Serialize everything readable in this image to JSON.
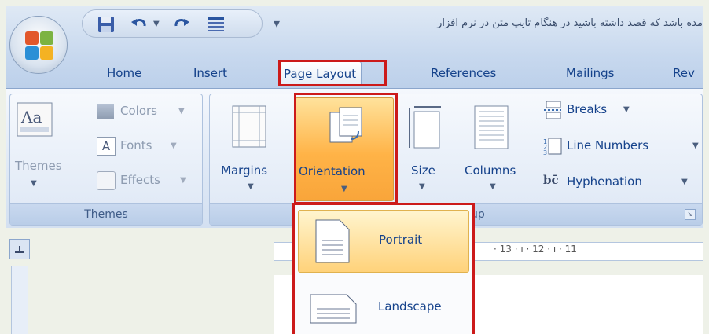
{
  "title_bar": {
    "doc_title": "مده باشد که قصد داشته باشید در هنگام تایپ متن در نرم افزار"
  },
  "tabs": [
    {
      "label": "Home"
    },
    {
      "label": "Insert"
    },
    {
      "label": "Page Layout",
      "active": true
    },
    {
      "label": "References"
    },
    {
      "label": "Mailings"
    },
    {
      "label": "Rev"
    }
  ],
  "ribbon": {
    "themes_group": {
      "label": "Themes",
      "themes_button": "Themes",
      "colors": "Colors",
      "fonts": "Fonts",
      "effects": "Effects"
    },
    "page_setup_group": {
      "label_visible_part": "up",
      "margins": "Margins",
      "orientation": "Orientation",
      "size": "Size",
      "columns": "Columns",
      "breaks": "Breaks",
      "line_numbers": "Line Numbers",
      "hyphenation": "Hyphenation"
    }
  },
  "orientation_menu": {
    "items": [
      {
        "label": "Portrait"
      },
      {
        "label": "Landscape"
      }
    ]
  },
  "ruler": {
    "text": "· 13 · ı · 12 · ı · 11"
  },
  "colors": {
    "highlight_red": "#cc1a1a",
    "tab_text": "#15428b",
    "hover_orange": "#ffd27a"
  }
}
